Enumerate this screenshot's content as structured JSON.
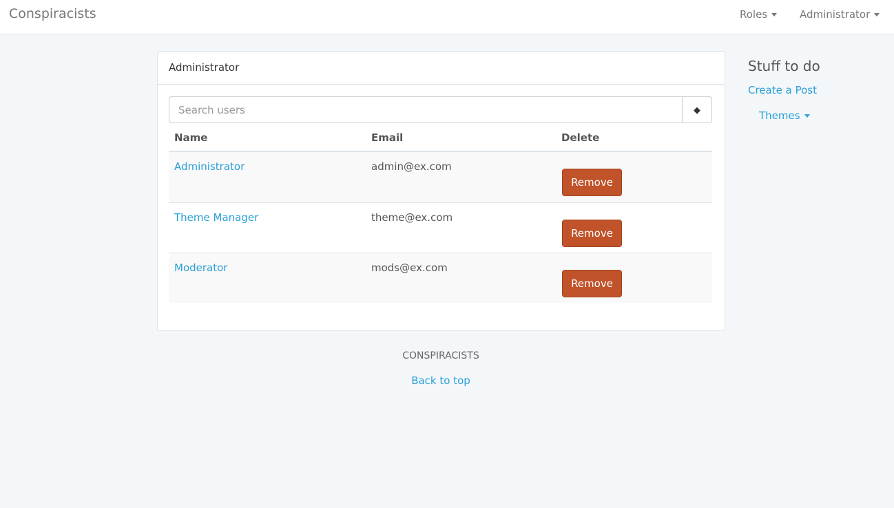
{
  "navbar": {
    "brand": "Conspiracists",
    "roles_label": "Roles",
    "user_label": "Administrator"
  },
  "panel": {
    "heading": "Administrator",
    "search": {
      "placeholder": "Search users",
      "button_glyph": "◆"
    },
    "table": {
      "columns": [
        "Name",
        "Email",
        "Delete"
      ],
      "rows": [
        {
          "name": "Administrator",
          "email": "admin@ex.com",
          "action": "Remove"
        },
        {
          "name": "Theme Manager",
          "email": "theme@ex.com",
          "action": "Remove"
        },
        {
          "name": "Moderator",
          "email": "mods@ex.com",
          "action": "Remove"
        }
      ]
    }
  },
  "sidebar": {
    "title": "Stuff to do",
    "create_post": "Create a Post",
    "themes": "Themes"
  },
  "footer": {
    "title": "CONSPIRACISTS",
    "back_to_top": "Back to top"
  },
  "colors": {
    "accent": "#2a9fd6",
    "danger": "#c1532a",
    "background": "#f3f7fa"
  }
}
